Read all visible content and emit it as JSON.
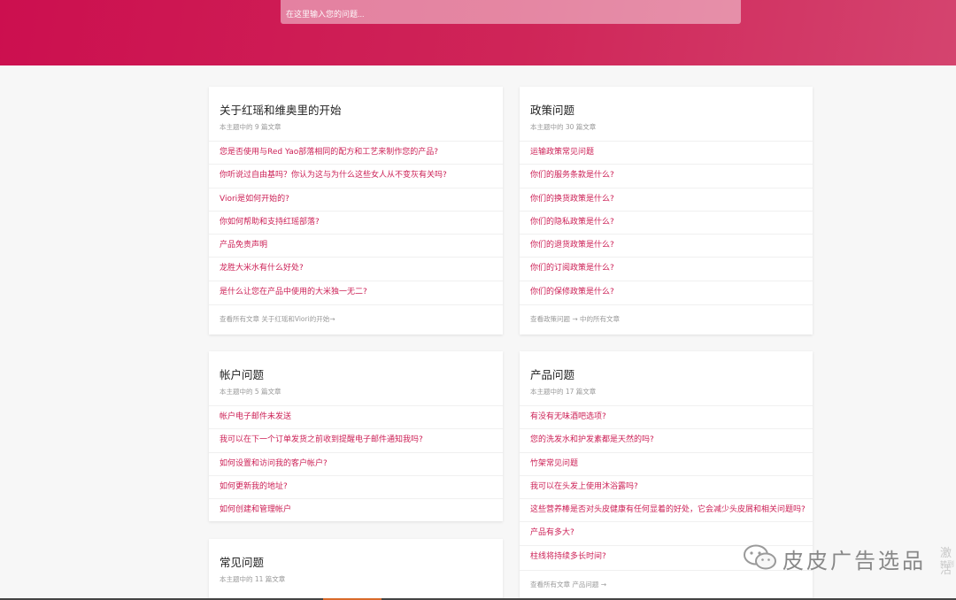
{
  "search": {
    "placeholder": "在这里输入您的问题..."
  },
  "sections": [
    {
      "title": "关于红瑶和维奥里的开始",
      "count_text": "本主题中的 9 篇文章",
      "articles": [
        "您是否使用与Red Yao部落相同的配方和工艺来制作您的产品?",
        "你听说过自由基吗？你认为这与为什么这些女人从不变灰有关吗?",
        "Viori是如何开始的?",
        "你如何帮助和支持红瑶部落?",
        "产品免责声明",
        "龙胜大米水有什么好处?",
        "是什么让您在产品中使用的大米独一无二?"
      ],
      "footer": "查看所有文章 关于红瑶和Viori的开始→"
    },
    {
      "title": "政策问题",
      "count_text": "本主题中的 30 篇文章",
      "articles": [
        "运输政策常见问题",
        "你们的服务条款是什么?",
        "你们的换货政策是什么?",
        "你们的隐私政策是什么?",
        "你们的退货政策是什么?",
        "你们的订阅政策是什么?",
        "你们的保修政策是什么?"
      ],
      "footer": "查看政策问题 → 中的所有文章"
    },
    {
      "title": "帐户问题",
      "count_text": "本主题中的 5 篇文章",
      "articles": [
        "帐户电子邮件未发送",
        "我可以在下一个订单发货之前收到提醒电子邮件通知我吗?",
        "如何设置和访问我的客户帐户?",
        "如何更新我的地址?",
        "如何创建和管理帐户"
      ]
    },
    {
      "title": "产品问题",
      "count_text": "本主题中的 17 篇文章",
      "articles": [
        "有没有无味酒吧选项?",
        "您的洗发水和护发素都是天然的吗?",
        "竹架常见问题",
        "我可以在头发上使用沐浴露吗?",
        "这些营养棒是否对头皮健康有任何显着的好处，它会减少头皮屑和相关问题吗?",
        "产品有多大?",
        "柱线将持续多长时间?"
      ],
      "footer": "查看所有文章 产品问题 →"
    },
    {
      "title": "常见问题",
      "count_text": "本主题中的 11 篇文章"
    }
  ],
  "watermark": {
    "text": "皮皮广告选品",
    "extra_top": "激活",
    "extra_bottom": "转到"
  },
  "colors": {
    "brand": "#cc1f55",
    "hero_start": "#cc0f4f",
    "hero_end": "#d4446f",
    "muted_text": "#999999"
  }
}
